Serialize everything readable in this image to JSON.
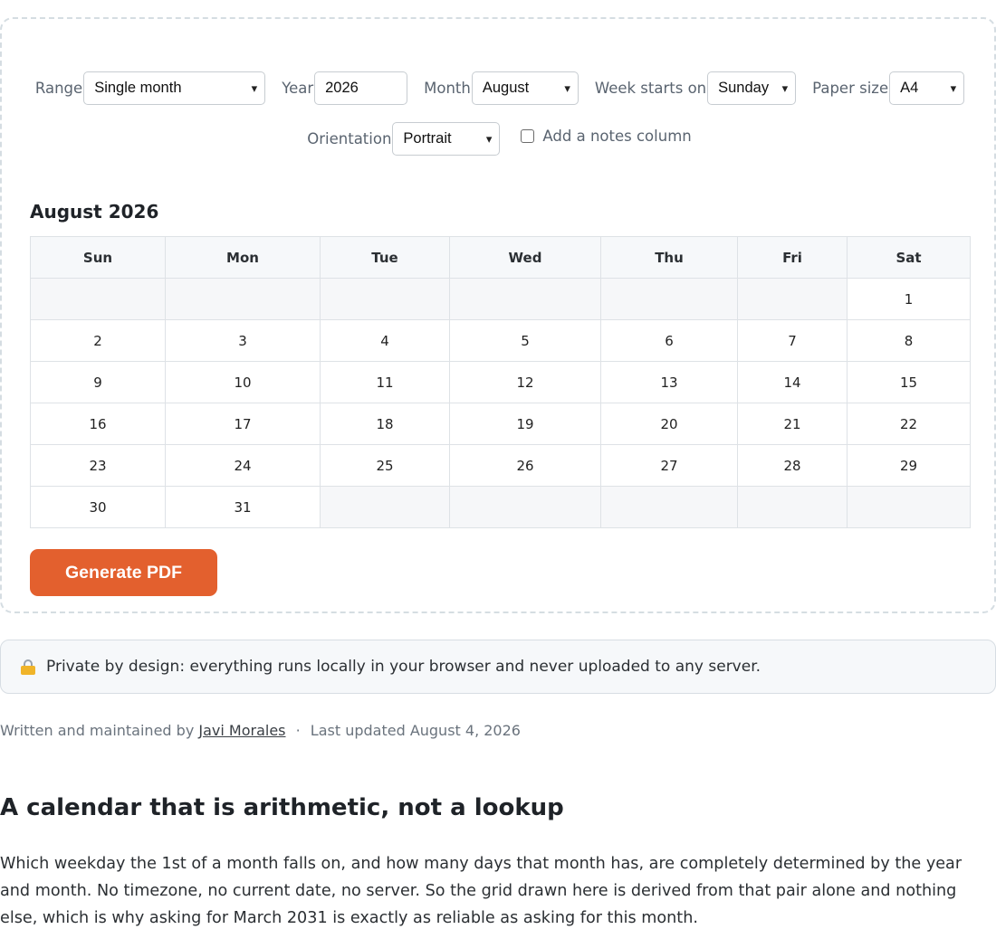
{
  "controls": {
    "range": {
      "label": "Range",
      "value": "Single month"
    },
    "year": {
      "label": "Year",
      "value": "2026"
    },
    "month": {
      "label": "Month",
      "value": "August"
    },
    "week_start": {
      "label": "Week starts on",
      "value": "Sunday"
    },
    "paper": {
      "label": "Paper size",
      "value": "A4"
    },
    "orientation": {
      "label": "Orientation",
      "value": "Portrait"
    },
    "notes": {
      "label": "Add a notes column",
      "checked": false
    }
  },
  "calendar": {
    "title": "August 2026",
    "weekdays": [
      "Sun",
      "Mon",
      "Tue",
      "Wed",
      "Thu",
      "Fri",
      "Sat"
    ],
    "weeks": [
      [
        "",
        "",
        "",
        "",
        "",
        "",
        "1"
      ],
      [
        "2",
        "3",
        "4",
        "5",
        "6",
        "7",
        "8"
      ],
      [
        "9",
        "10",
        "11",
        "12",
        "13",
        "14",
        "15"
      ],
      [
        "16",
        "17",
        "18",
        "19",
        "20",
        "21",
        "22"
      ],
      [
        "23",
        "24",
        "25",
        "26",
        "27",
        "28",
        "29"
      ],
      [
        "30",
        "31",
        "",
        "",
        "",
        "",
        ""
      ]
    ]
  },
  "generate_label": "Generate PDF",
  "privacy": {
    "icon": "lock-icon",
    "text": "Private by design: everything runs locally in your browser and never uploaded to any server."
  },
  "byline": {
    "prefix": "Written and maintained by",
    "author": "Javi Morales",
    "separator": "·",
    "updated": "Last updated August 4, 2026"
  },
  "article": {
    "heading": "A calendar that is arithmetic, not a lookup",
    "paragraph": "Which weekday the 1st of a month falls on, and how many days that month has, are completely determined by the year and month. No timezone, no current date, no server. So the grid drawn here is derived from that pair alone and nothing else, which is why asking for March 2031 is exactly as reliable as asking for this month."
  },
  "colors": {
    "accent": "#e3602e",
    "card_border": "#d5dde2",
    "empty_cell": "#f6f7f9"
  }
}
